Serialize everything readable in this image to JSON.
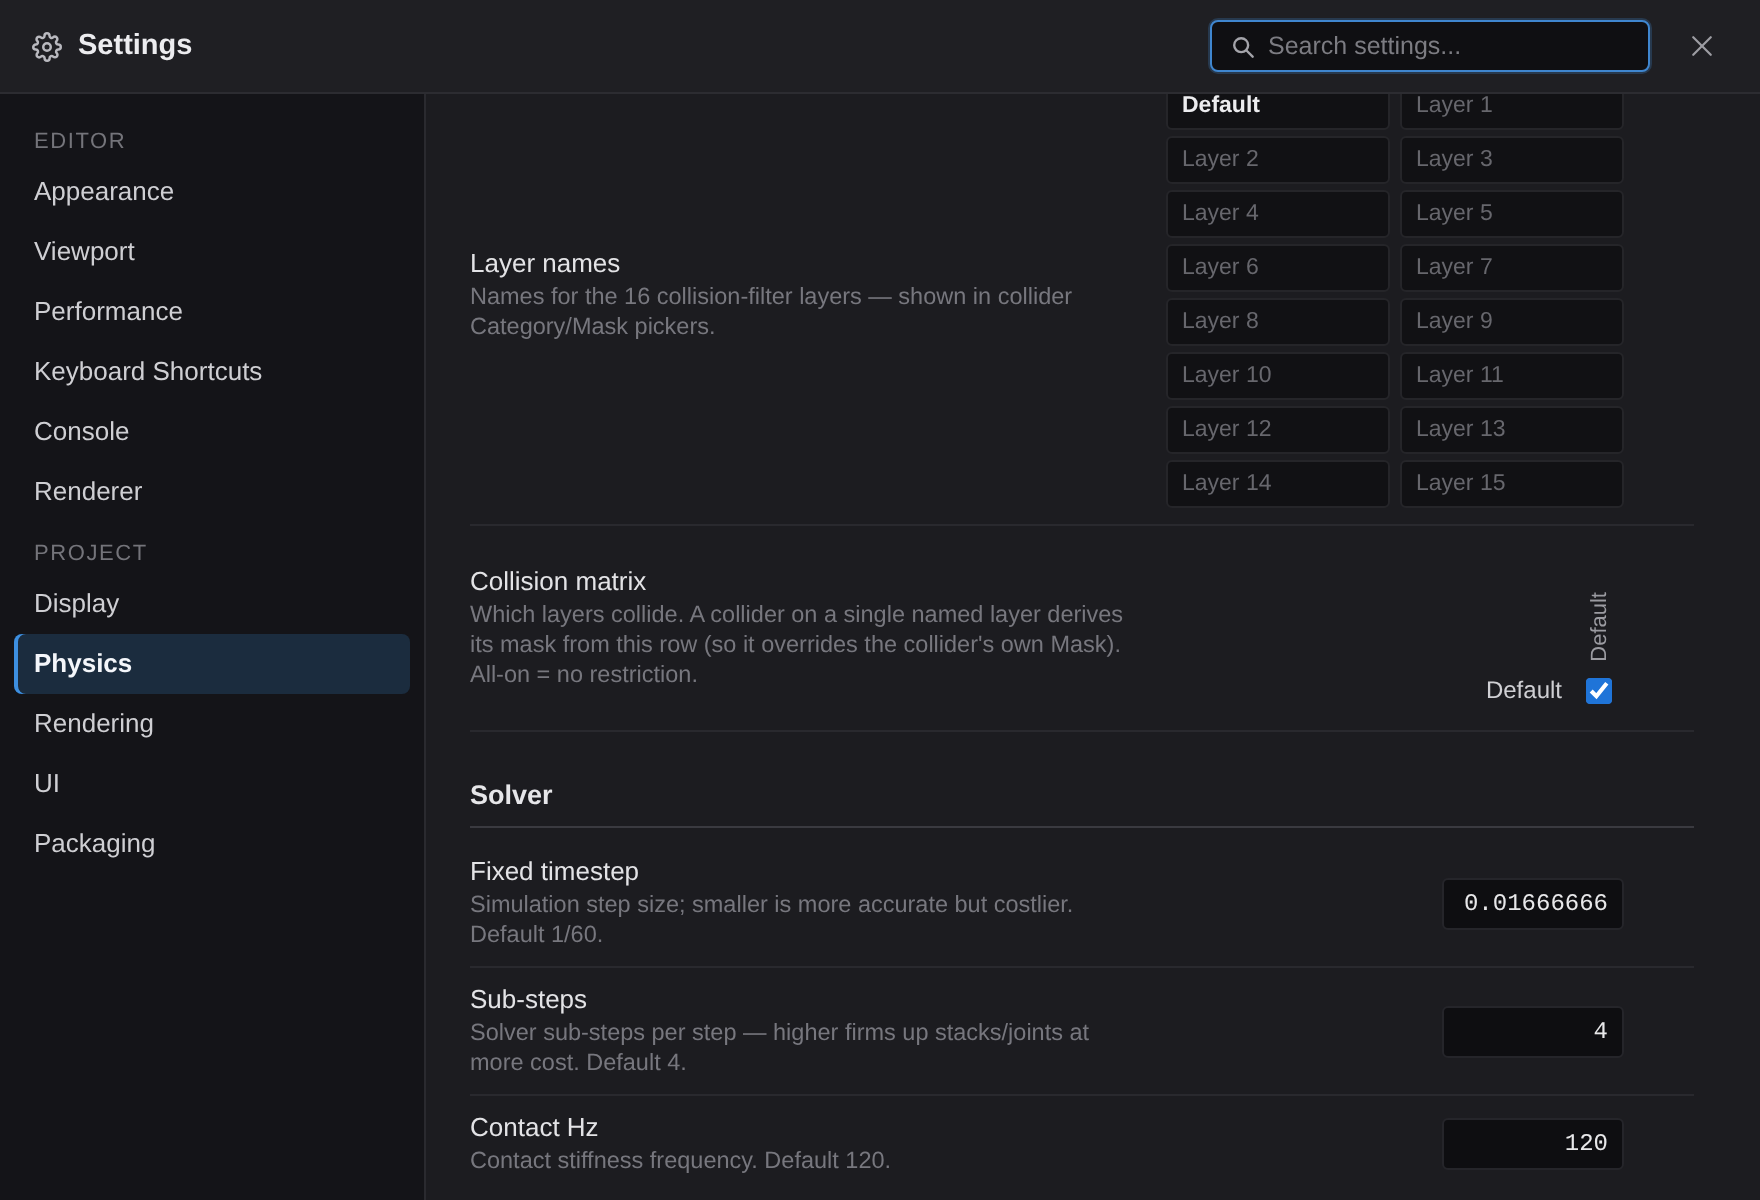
{
  "window": {
    "title": "Settings"
  },
  "search": {
    "placeholder": "Search settings...",
    "focused": true
  },
  "sidebar": {
    "sections": [
      {
        "heading": "EDITOR",
        "items": [
          {
            "label": "Appearance",
            "selected": false
          },
          {
            "label": "Viewport",
            "selected": false
          },
          {
            "label": "Performance",
            "selected": false
          },
          {
            "label": "Keyboard Shortcuts",
            "selected": false
          },
          {
            "label": "Console",
            "selected": false
          },
          {
            "label": "Renderer",
            "selected": false
          }
        ]
      },
      {
        "heading": "PROJECT",
        "items": [
          {
            "label": "Display",
            "selected": false
          },
          {
            "label": "Physics",
            "selected": true
          },
          {
            "label": "Rendering",
            "selected": false
          },
          {
            "label": "UI",
            "selected": false
          },
          {
            "label": "Packaging",
            "selected": false
          }
        ]
      }
    ]
  },
  "settings": [
    {
      "kind": "layer_names",
      "title": "Layer names",
      "description": "Names for the 16 collision-filter layers — shown in collider Category/Mask pickers.",
      "layers": [
        {
          "value": "Default"
        },
        {
          "placeholder": "Layer 1"
        },
        {
          "placeholder": "Layer 2"
        },
        {
          "placeholder": "Layer 3"
        },
        {
          "placeholder": "Layer 4"
        },
        {
          "placeholder": "Layer 5"
        },
        {
          "placeholder": "Layer 6"
        },
        {
          "placeholder": "Layer 7"
        },
        {
          "placeholder": "Layer 8"
        },
        {
          "placeholder": "Layer 9"
        },
        {
          "placeholder": "Layer 10"
        },
        {
          "placeholder": "Layer 11"
        },
        {
          "placeholder": "Layer 12"
        },
        {
          "placeholder": "Layer 13"
        },
        {
          "placeholder": "Layer 14"
        },
        {
          "placeholder": "Layer 15"
        }
      ]
    },
    {
      "kind": "collision_matrix",
      "title": "Collision matrix",
      "description": "Which layers collide. A collider on a single named layer derives its mask from this row (so it overrides the collider's own Mask). All-on = no restriction.",
      "matrix": {
        "columns": [
          "Default"
        ],
        "rows": [
          {
            "label": "Default",
            "cells": [
              {
                "checked": true
              }
            ]
          }
        ]
      }
    },
    {
      "kind": "heading",
      "title": "Solver"
    },
    {
      "kind": "number",
      "title": "Fixed timestep",
      "description": "Simulation step size; smaller is more accurate but costlier. Default 1/60.",
      "value": "0.01666666"
    },
    {
      "kind": "number",
      "title": "Sub-steps",
      "description": "Solver sub-steps per step — higher firms up stacks/joints at more cost. Default 4.",
      "value": "4"
    },
    {
      "kind": "number",
      "title": "Contact Hz",
      "description": "Contact stiffness frequency. Default 120.",
      "value": "120"
    }
  ]
}
